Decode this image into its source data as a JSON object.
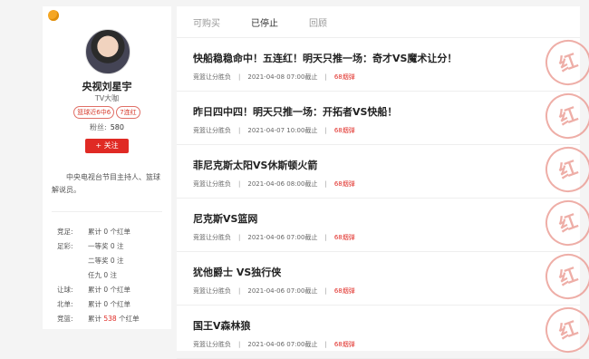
{
  "profile": {
    "name": "央视刘星宇",
    "subtitle": "TV大咖",
    "badges": [
      "篮球近6中6",
      "7连红"
    ],
    "fans_label": "粉丝:",
    "fans_count": "580",
    "follow_label": "+ 关注",
    "bio": "中央电视台节目主持人、篮球解说员。"
  },
  "stats": [
    {
      "label": "竞足:",
      "value": "累计 0 个红单"
    },
    {
      "label": "足彩:",
      "value": "一等奖 0 注"
    },
    {
      "label": "",
      "value": "二等奖 0 注"
    },
    {
      "label": "",
      "value": "任九 0 注"
    },
    {
      "label": "让球:",
      "value": "累计 0 个红单"
    },
    {
      "label": "北单:",
      "value": "累计 0 个红单"
    },
    {
      "label": "竞篮:",
      "value_prefix": "累计 ",
      "value_highlight": "538",
      "value_suffix": " 个红单"
    }
  ],
  "tabs": [
    "可购买",
    "已停止",
    "回顾"
  ],
  "active_tab": "已停止",
  "articles": [
    {
      "title": "快船稳稳命中！五连红！明天只推一场：奇才VS魔术让分！",
      "category": "竞篮让分胜负",
      "deadline": "2021-04-08 07:00截止",
      "price": "68烟弹"
    },
    {
      "title": "昨日四中四！明天只推一场：开拓者VS快船！",
      "category": "竞篮让分胜负",
      "deadline": "2021-04-07 10:00截止",
      "price": "68烟弹"
    },
    {
      "title": "菲尼克斯太阳VS休斯顿火箭",
      "category": "竞篮让分胜负",
      "deadline": "2021-04-06 08:00截止",
      "price": "68烟弹"
    },
    {
      "title": "尼克斯VS篮网",
      "category": "竞篮让分胜负",
      "deadline": "2021-04-06 07:00截止",
      "price": "68烟弹"
    },
    {
      "title": "犹他爵士 VS独行侠",
      "category": "竞篮让分胜负",
      "deadline": "2021-04-06 07:00截止",
      "price": "68烟弹"
    },
    {
      "title": "国王V森林狼",
      "category": "竞篮让分胜负",
      "deadline": "2021-04-06 07:00截止",
      "price": "68烟弹"
    }
  ],
  "stamp_text": "红"
}
